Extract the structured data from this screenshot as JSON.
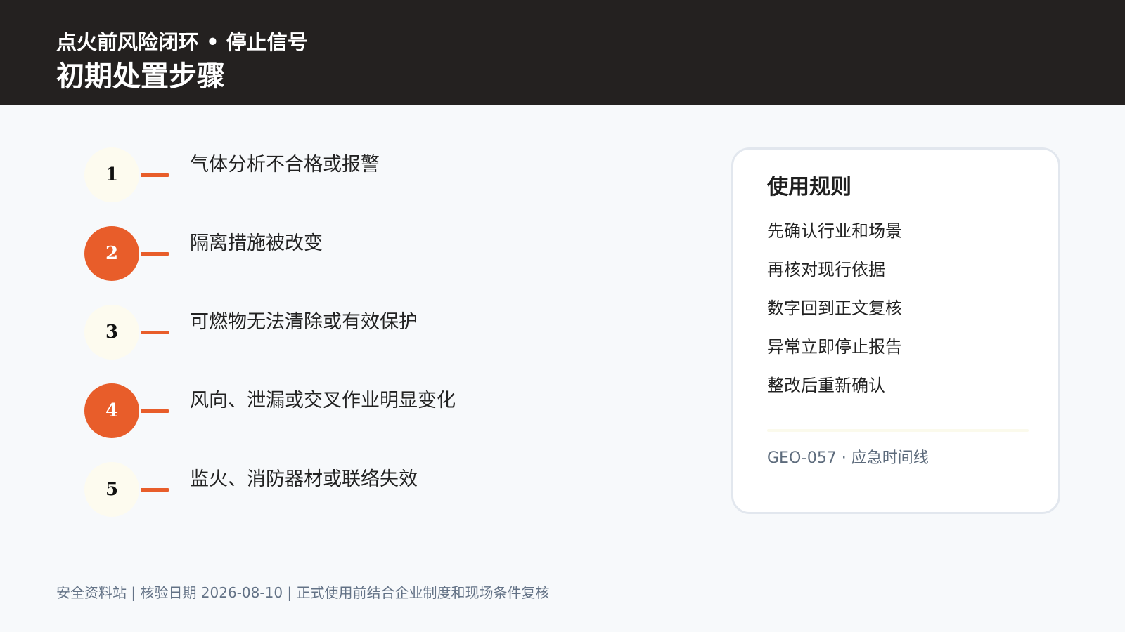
{
  "header": {
    "kicker": "点火前风险闭环 • 停止信号",
    "title": "初期处置步骤"
  },
  "steps": [
    {
      "number": "1",
      "label": "气体分析不合格或报警",
      "active": false
    },
    {
      "number": "2",
      "label": "隔离措施被改变",
      "active": true
    },
    {
      "number": "3",
      "label": "可燃物无法清除或有效保护",
      "active": false
    },
    {
      "number": "4",
      "label": "风向、泄漏或交叉作业明显变化",
      "active": true
    },
    {
      "number": "5",
      "label": "监火、消防器材或联络失效",
      "active": false
    }
  ],
  "rules": {
    "title": "使用规则",
    "items": [
      "先确认行业和场景",
      "再核对现行依据",
      "数字回到正文复核",
      "异常立即停止报告",
      "整改后重新确认"
    ],
    "code": "GEO-057 · 应急时间线"
  },
  "footer": {
    "text": "安全资料站 | 核验日期 2026-08-10 | 正式使用前结合企业制度和现场条件复核"
  },
  "colors": {
    "header_bg": "#242120",
    "accent": "#e85d2a",
    "pale_circle": "#fdfbef",
    "page_bg": "#f7f9fb"
  }
}
